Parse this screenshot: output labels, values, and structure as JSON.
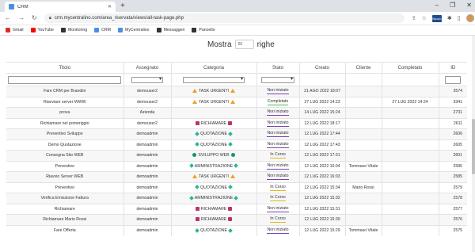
{
  "browser": {
    "tab_title": "CRM",
    "url": "crm.mycentralino.com/area_riservata/views/all-task-page.php",
    "ext_badge": "Nuovo"
  },
  "bookmarks": [
    {
      "label": "Gmail",
      "color": "#d93025"
    },
    {
      "label": "YouTube",
      "color": "#ff0000"
    },
    {
      "label": "Monitoring",
      "color": "#333333"
    },
    {
      "label": "CRM",
      "color": "#4a90e2"
    },
    {
      "label": "MyCentralino",
      "color": "#4a90e2"
    },
    {
      "label": "Messaggeri",
      "color": "#333333"
    },
    {
      "label": "Panoello",
      "color": "#333333"
    }
  ],
  "page": {
    "mostra_label": "Mostra",
    "mostra_value": "50",
    "righe_label": "righe"
  },
  "columns": [
    "Titolo",
    "Assegnato",
    "Categoria",
    "Stato",
    "Creato",
    "Cliente",
    "Completato",
    "ID"
  ],
  "rows": [
    {
      "titolo": "Fare CRM per Brandini",
      "assegnato": "demouser2",
      "categoria": "TASK URGENTI",
      "cat_icon": "warn",
      "stato": "Non iniziato",
      "stato_color": "#7b3fb5",
      "creato": "21 AGO 2022 18:07",
      "cliente": "",
      "completato": "",
      "id": "3574"
    },
    {
      "titolo": "Riavviare server WWW",
      "assegnato": "demouser2",
      "categoria": "TASK URGENTI",
      "cat_icon": "warn",
      "stato": "Completato",
      "stato_color": "#4cbb4c",
      "creato": "27 LUG 2022 14:23",
      "cliente": "",
      "completato": "27 LUG 2022 14:24",
      "id": "3341"
    },
    {
      "titolo": "prova",
      "assegnato": "Azienda",
      "categoria": "",
      "cat_icon": "",
      "stato": "Non iniziato",
      "stato_color": "#7b3fb5",
      "creato": "14 LUG 2022 15:24",
      "cliente": "",
      "completato": "",
      "id": "2731"
    },
    {
      "titolo": "Richiamare nel pomeriggio",
      "assegnato": "demouser2",
      "categoria": "RICHIAMARE",
      "cat_icon": "call",
      "stato": "Non iniziato",
      "stato_color": "#7b3fb5",
      "creato": "12 LUG 2022 18:17",
      "cliente": "",
      "completato": "",
      "id": "2611"
    },
    {
      "titolo": "Preventivo Sviluppo",
      "assegnato": "demoadmin",
      "categoria": "QUOTAZIONE",
      "cat_icon": "diam",
      "stato": "Non iniziato",
      "stato_color": "#7b3fb5",
      "creato": "12 LUG 2022 17:44",
      "cliente": "",
      "completato": "",
      "id": "2606"
    },
    {
      "titolo": "Demo Quotazione",
      "assegnato": "demoadmin",
      "categoria": "QUOTAZIONE",
      "cat_icon": "diam",
      "stato": "Non iniziato",
      "stato_color": "#7b3fb5",
      "creato": "12 LUG 2022 17:43",
      "cliente": "",
      "completato": "",
      "id": "2605"
    },
    {
      "titolo": "Consegna Sito WEB",
      "assegnato": "demoadmin",
      "categoria": "SVILUPPO WEB",
      "cat_icon": "globe",
      "stato": "In Corso",
      "stato_color": "#e9b21c",
      "creato": "12 LUG 2022 17:31",
      "cliente": "",
      "completato": "",
      "id": "2601"
    },
    {
      "titolo": "Preventivo",
      "assegnato": "demoadmin",
      "categoria": "AMMINISTRAZIONE",
      "cat_icon": "diam",
      "stato": "Non iniziato",
      "stato_color": "#7b3fb5",
      "creato": "12 LUG 2022 16:04",
      "cliente": "Tommaso Vitale",
      "completato": "",
      "id": "2586"
    },
    {
      "titolo": "Riavvio Server WEB",
      "assegnato": "demoadmin",
      "categoria": "TASK URGENTI",
      "cat_icon": "warn",
      "stato": "Non iniziato",
      "stato_color": "#7b3fb5",
      "creato": "12 LUG 2022 16:03",
      "cliente": "",
      "completato": "",
      "id": "2585"
    },
    {
      "titolo": "Preventivo",
      "assegnato": "demoadmin",
      "categoria": "QUOTAZIONE",
      "cat_icon": "diam",
      "stato": "In Corso",
      "stato_color": "#e9b21c",
      "creato": "12 LUG 2022 15:34",
      "cliente": "Mario Rossi",
      "completato": "",
      "id": "2579"
    },
    {
      "titolo": "Verifica Emissione Fattura",
      "assegnato": "demoadmin",
      "categoria": "AMMINISTRAZIONE",
      "cat_icon": "diam",
      "stato": "In Corso",
      "stato_color": "#e9b21c",
      "creato": "12 LUG 2022 15:32",
      "cliente": "",
      "completato": "",
      "id": "2578"
    },
    {
      "titolo": "Richiamare",
      "assegnato": "demoadmin",
      "categoria": "RICHIAMARE",
      "cat_icon": "call",
      "stato": "Non iniziato",
      "stato_color": "#7b3fb5",
      "creato": "12 LUG 2022 15:31",
      "cliente": "",
      "completato": "",
      "id": "2577"
    },
    {
      "titolo": "Richiamare Mario Rossi",
      "assegnato": "demoadmin",
      "categoria": "RICHIAMARE",
      "cat_icon": "call",
      "stato": "In Corso",
      "stato_color": "#e9b21c",
      "creato": "12 LUG 2022 15:30",
      "cliente": "",
      "completato": "",
      "id": "2576"
    },
    {
      "titolo": "Fare Offerta",
      "assegnato": "demoadmin",
      "categoria": "QUOTAZIONE",
      "cat_icon": "diam",
      "stato": "Non iniziato",
      "stato_color": "#7b3fb5",
      "creato": "12 LUG 2022 15:29",
      "cliente": "Tommaso Vitale",
      "completato": "",
      "id": "2575"
    }
  ]
}
